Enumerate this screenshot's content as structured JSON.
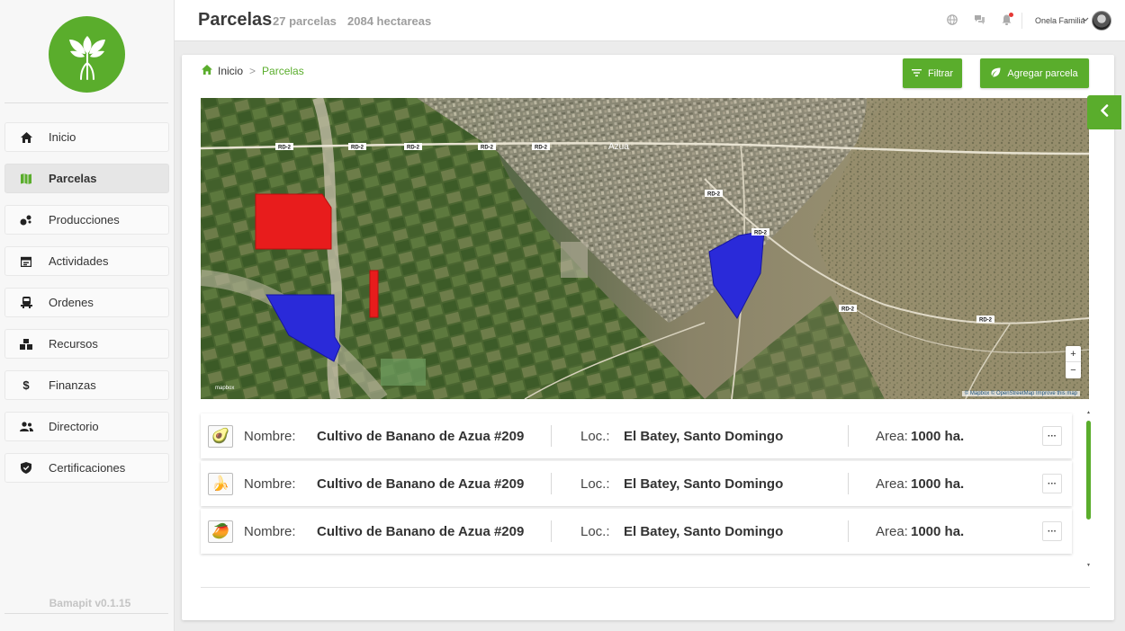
{
  "app": {
    "version": "Bamapit v0.1.15",
    "accent_color": "#5aad2c"
  },
  "sidebar": {
    "items": [
      {
        "label": "Inicio",
        "icon": "home-icon",
        "active": false
      },
      {
        "label": "Parcelas",
        "icon": "map-icon",
        "active": true
      },
      {
        "label": "Producciones",
        "icon": "seedling-icon",
        "active": false
      },
      {
        "label": "Actividades",
        "icon": "calendar-icon",
        "active": false
      },
      {
        "label": "Ordenes",
        "icon": "truck-icon",
        "active": false
      },
      {
        "label": "Recursos",
        "icon": "boxes-icon",
        "active": false
      },
      {
        "label": "Finanzas",
        "icon": "dollar-icon",
        "active": false
      },
      {
        "label": "Directorio",
        "icon": "users-icon",
        "active": false
      },
      {
        "label": "Certificaciones",
        "icon": "shield-icon",
        "active": false
      }
    ]
  },
  "header": {
    "title": "Parcelas",
    "parcel_count": "27 parcelas",
    "hectares": "2084 hectareas",
    "user_name": "Onela Familia",
    "icons": [
      "globe-icon",
      "chat-icon",
      "bell-icon"
    ]
  },
  "breadcrumb": {
    "home": "Inicio",
    "separator": ">",
    "current": "Parcelas"
  },
  "actions": {
    "filter_label": "Filtrar",
    "add_label": "Agregar parcela"
  },
  "map": {
    "city_label": "Azua",
    "road_labels": [
      "RD-2"
    ],
    "zoom_in": "+",
    "zoom_out": "−",
    "attribution": "© Mapbox © OpenStreetMap Improve this map",
    "logo": "mapbox",
    "parcel_colors": [
      "#e81c1c",
      "#2a2ad9"
    ]
  },
  "parcels": [
    {
      "icon": "avocado-icon",
      "emoji": "🥑",
      "name_label": "Nombre:",
      "name": "Cultivo de Banano de Azua #209",
      "loc_label": "Loc.:",
      "location": "El Batey, Santo Domingo",
      "area_label": "Area:",
      "area": "1000 ha.",
      "more": "···"
    },
    {
      "icon": "banana-icon",
      "emoji": "🍌",
      "name_label": "Nombre:",
      "name": "Cultivo de Banano de Azua #209",
      "loc_label": "Loc.:",
      "location": "El Batey, Santo Domingo",
      "area_label": "Area:",
      "area": "1000 ha.",
      "more": "···"
    },
    {
      "icon": "mango-icon",
      "emoji": "🥭",
      "name_label": "Nombre:",
      "name": "Cultivo de Banano de Azua #209",
      "loc_label": "Loc.:",
      "location": "El Batey, Santo Domingo",
      "area_label": "Area:",
      "area": "1000 ha.",
      "more": "···"
    }
  ]
}
